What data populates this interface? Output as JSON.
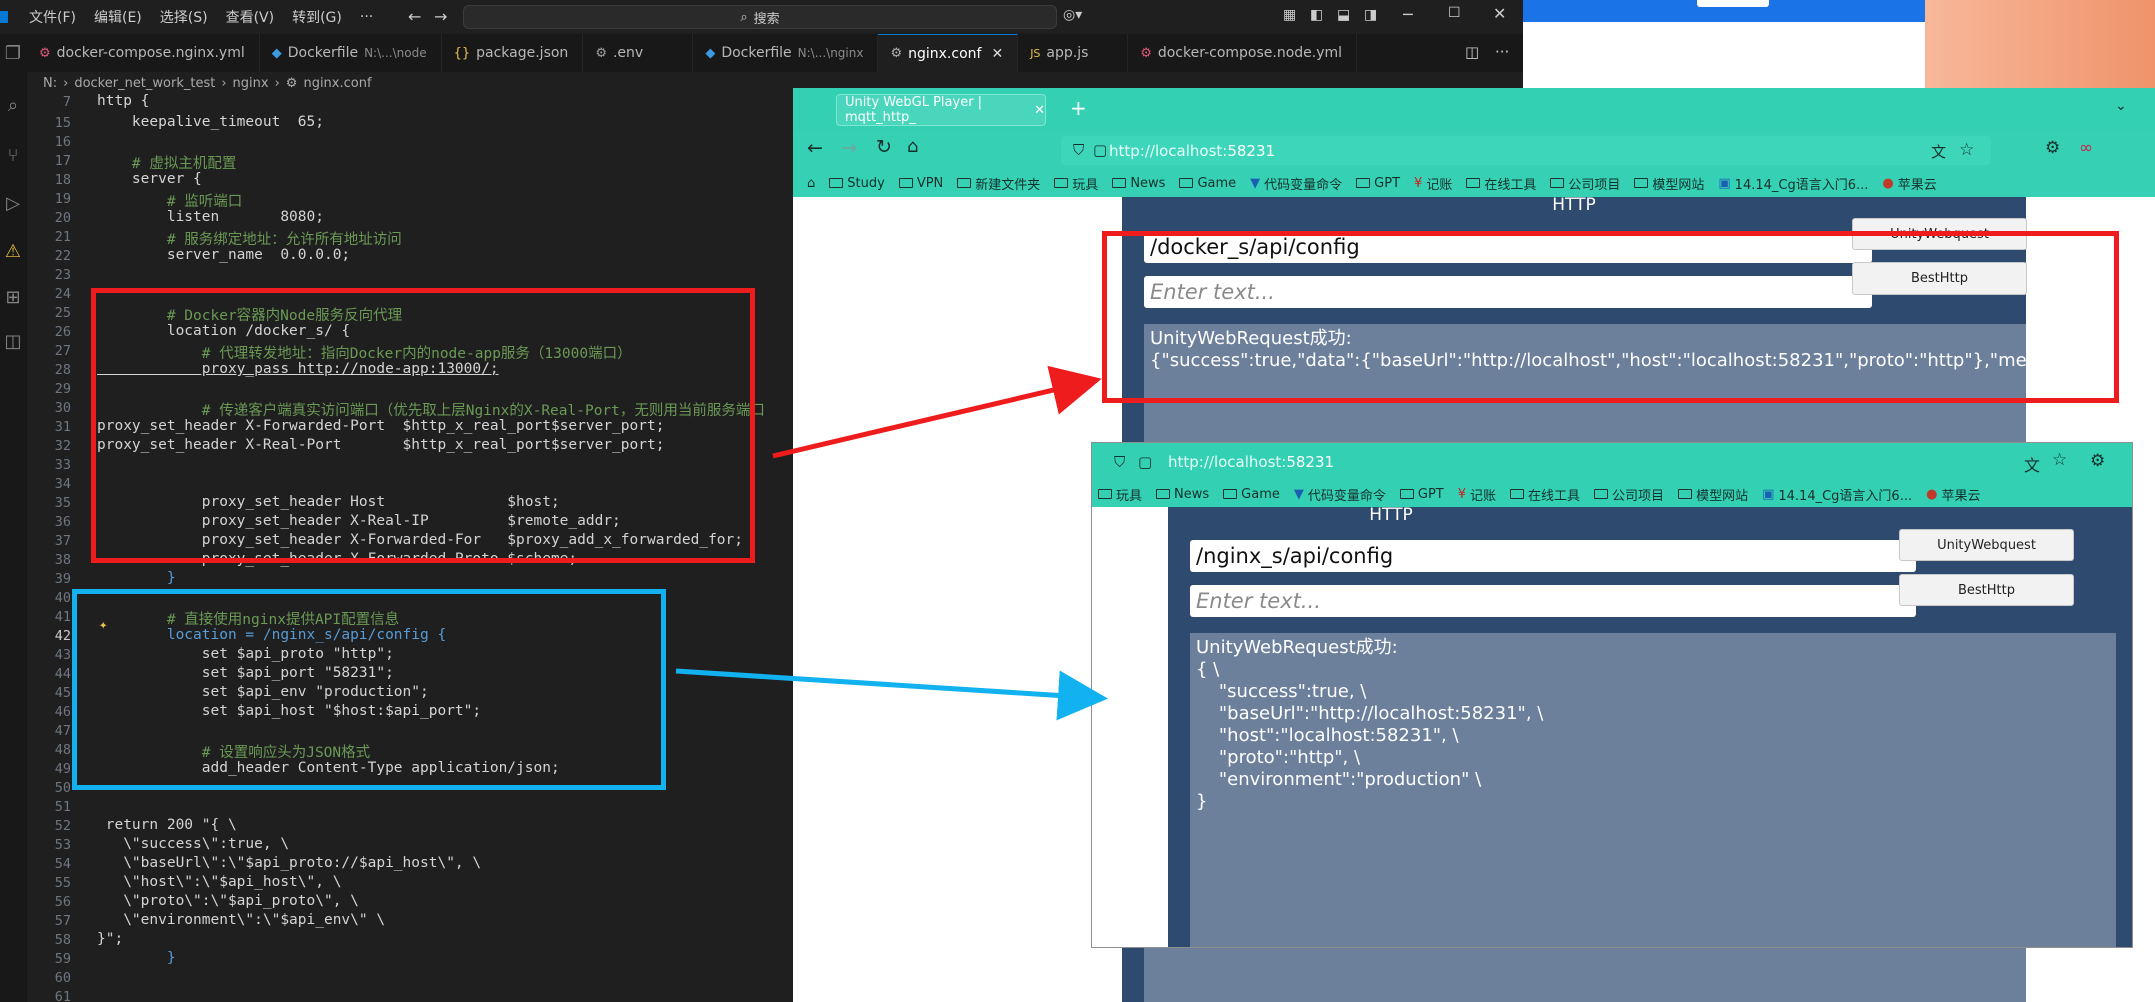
{
  "vscode": {
    "menus": [
      "文件(F)",
      "编辑(E)",
      "选择(S)",
      "查看(V)",
      "转到(G)",
      "···"
    ],
    "search_placeholder": "搜索",
    "tabs": [
      {
        "label": "docker-compose.nginx.yml",
        "hint": "",
        "icon": "yaml-icon",
        "active": false
      },
      {
        "label": "Dockerfile",
        "hint": "N:\\...\\node",
        "icon": "docker-icon",
        "active": false
      },
      {
        "label": "package.json",
        "hint": "",
        "icon": "json-icon",
        "active": false
      },
      {
        "label": ".env",
        "hint": "",
        "icon": "gear-icon",
        "active": false
      },
      {
        "label": "Dockerfile",
        "hint": "N:\\...\\nginx",
        "icon": "docker-icon",
        "active": false
      },
      {
        "label": "nginx.conf",
        "hint": "",
        "icon": "gear-icon",
        "active": true
      },
      {
        "label": "app.js",
        "hint": "",
        "icon": "js-icon",
        "active": false
      },
      {
        "label": "docker-compose.node.yml",
        "hint": "",
        "icon": "yaml-icon",
        "active": false
      }
    ],
    "breadcrumb": [
      "N:",
      "docker_net_work_test",
      "nginx",
      "nginx.conf"
    ],
    "sticky": "http {",
    "lines": [
      {
        "n": "15",
        "t": "    keepalive_timeout  65;",
        "c": ""
      },
      {
        "n": "16",
        "t": "",
        "c": ""
      },
      {
        "n": "17",
        "t": "    # 虚拟主机配置",
        "c": "cm"
      },
      {
        "n": "18",
        "t": "    server {",
        "c": ""
      },
      {
        "n": "19",
        "t": "        # 监听端口",
        "c": "cm"
      },
      {
        "n": "20",
        "t": "        listen       8080;",
        "c": ""
      },
      {
        "n": "21",
        "t": "        # 服务绑定地址：允许所有地址访问",
        "c": "cm"
      },
      {
        "n": "22",
        "t": "        server_name  0.0.0.0;",
        "c": ""
      },
      {
        "n": "23",
        "t": "",
        "c": ""
      },
      {
        "n": "24",
        "t": "",
        "c": ""
      },
      {
        "n": "25",
        "t": "        # Docker容器内Node服务反向代理",
        "c": "cm"
      },
      {
        "n": "26",
        "t": "        location /docker_s/ {",
        "c": ""
      },
      {
        "n": "27",
        "t": "            # 代理转发地址：指向Docker内的node-app服务（13000端口）",
        "c": "cm"
      },
      {
        "n": "28",
        "t": "            proxy_pass http://node-app:13000/;",
        "c": "ul"
      },
      {
        "n": "29",
        "t": "",
        "c": ""
      },
      {
        "n": "30",
        "t": "            # 传递客户端真实访问端口（优先取上层Nginx的X-Real-Port，无则用当前服务端口",
        "c": "cm"
      },
      {
        "n": "31",
        "t": "proxy_set_header X-Forwarded-Port  $http_x_real_port$server_port;",
        "c": ""
      },
      {
        "n": "32",
        "t": "proxy_set_header X-Real-Port       $http_x_real_port$server_port;",
        "c": ""
      },
      {
        "n": "33",
        "t": "",
        "c": ""
      },
      {
        "n": "34",
        "t": "",
        "c": ""
      },
      {
        "n": "35",
        "t": "            proxy_set_header Host              $host;",
        "c": ""
      },
      {
        "n": "36",
        "t": "            proxy_set_header X-Real-IP         $remote_addr;",
        "c": ""
      },
      {
        "n": "37",
        "t": "            proxy_set_header X-Forwarded-For   $proxy_add_x_forwarded_for;",
        "c": ""
      },
      {
        "n": "38",
        "t": "            proxy_set_header X-Forwarded-Proto $scheme;",
        "c": ""
      },
      {
        "n": "39",
        "t": "        }",
        "c": "kw"
      },
      {
        "n": "40",
        "t": "",
        "c": ""
      },
      {
        "n": "41",
        "t": "        # 直接使用nginx提供API配置信息",
        "c": "cm"
      },
      {
        "n": "42",
        "t": "        location = /nginx_s/api/config {",
        "c": "kw"
      },
      {
        "n": "43",
        "t": "            set $api_proto \"http\";",
        "c": ""
      },
      {
        "n": "44",
        "t": "            set $api_port \"58231\";",
        "c": ""
      },
      {
        "n": "45",
        "t": "            set $api_env \"production\";",
        "c": ""
      },
      {
        "n": "46",
        "t": "            set $api_host \"$host:$api_port\";",
        "c": ""
      },
      {
        "n": "47",
        "t": "",
        "c": ""
      },
      {
        "n": "48",
        "t": "            # 设置响应头为JSON格式",
        "c": "cm"
      },
      {
        "n": "49",
        "t": "            add_header Content-Type application/json;",
        "c": ""
      },
      {
        "n": "50",
        "t": "",
        "c": ""
      },
      {
        "n": "51",
        "t": "",
        "c": ""
      },
      {
        "n": "52",
        "t": " return 200 \"{ \\",
        "c": ""
      },
      {
        "n": "53",
        "t": "   \\\"success\\\":true, \\",
        "c": ""
      },
      {
        "n": "54",
        "t": "   \\\"baseUrl\\\":\\\"$api_proto://$api_host\\\", \\",
        "c": ""
      },
      {
        "n": "55",
        "t": "   \\\"host\\\":\\\"$api_host\\\", \\",
        "c": ""
      },
      {
        "n": "56",
        "t": "   \\\"proto\\\":\\\"$api_proto\\\", \\",
        "c": ""
      },
      {
        "n": "57",
        "t": "   \\\"environment\\\":\\\"$api_env\\\" \\",
        "c": ""
      },
      {
        "n": "58",
        "t": "}\";",
        "c": ""
      },
      {
        "n": "59",
        "t": "        }",
        "c": "kw"
      },
      {
        "n": "60",
        "t": "",
        "c": ""
      },
      {
        "n": "61",
        "t": "",
        "c": ""
      }
    ],
    "sticky_line_no": "7"
  },
  "browser1": {
    "tab_title": "Unity WebGL Player | mqtt_http_",
    "url_prefix": "http://localhost:",
    "url_port": "58231",
    "bookmarks": [
      "Study",
      "VPN",
      "新建文件夹",
      "玩具",
      "News",
      "Game",
      "代码变量命令",
      "GPT",
      "记账",
      "在线工具",
      "公司项目",
      "模型网站",
      "14.14_Cg语言入门6...",
      "苹果云"
    ],
    "app": {
      "title": "HTTP",
      "url_input": "/docker_s/api/config",
      "text_placeholder": "Enter text...",
      "btn1": "UnityWebquest",
      "btn2": "BestHttp",
      "output": "UnityWebRequest成功:\n{\"success\":true,\"data\":{\"baseUrl\":\"http://localhost\",\"host\":\"localhost:58231\",\"proto\":\"http\"},\"message\":\"端"
    }
  },
  "browser2": {
    "url_prefix": "http://localhost:",
    "url_port": "58231",
    "bookmarks": [
      "玩具",
      "News",
      "Game",
      "代码变量命令",
      "GPT",
      "记账",
      "在线工具",
      "公司项目",
      "模型网站",
      "14.14_Cg语言入门6...",
      "苹果云"
    ],
    "app": {
      "title": "HTTP",
      "url_input": "/nginx_s/api/config",
      "text_placeholder": "Enter text...",
      "btn1": "UnityWebquest",
      "btn2": "BestHttp",
      "output": "UnityWebRequest成功:\n{ \\\n    \"success\":true, \\\n    \"baseUrl\":\"http://localhost:58231\", \\\n    \"host\":\"localhost:58231\", \\\n    \"proto\":\"http\", \\\n    \"environment\":\"production\" \\\n}"
    }
  },
  "colors": {
    "red_box": "#ee1c1c",
    "blue_box": "#12b1ef",
    "browser_theme": "#34d0b4",
    "unity_bg": "#2e4a6f"
  }
}
